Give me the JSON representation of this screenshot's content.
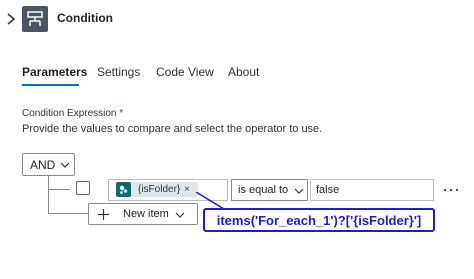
{
  "header": {
    "title": "Condition",
    "icon": "condition-icon",
    "expand_icon": "chevron-right-icon",
    "icon_bg": "#4b5563"
  },
  "tabs": [
    {
      "label": "Parameters",
      "active": true
    },
    {
      "label": "Settings",
      "active": false
    },
    {
      "label": "Code View",
      "active": false
    },
    {
      "label": "About",
      "active": false
    }
  ],
  "condition_expression": {
    "label": "Condition Expression",
    "required_marker": "*",
    "description": "Provide the values to compare and select the operator to use.",
    "group_operator": "AND",
    "rows": [
      {
        "left_operand": {
          "token_label": "{isFolder}",
          "token_icon": "sharepoint-icon",
          "remove_glyph": "×"
        },
        "operator": "is equal to",
        "right_operand": "false"
      }
    ],
    "more_glyph": "···",
    "new_item_label": "New item"
  },
  "annotation": {
    "text": "items('For_each_1')?['{isFolder}']",
    "color": "#1a1fc8"
  },
  "colors": {
    "accent": "#0f6cbd",
    "token_bg": "#dfe7ee",
    "token_icon_bg": "#0f6b6b",
    "required": "#c50f1f"
  }
}
